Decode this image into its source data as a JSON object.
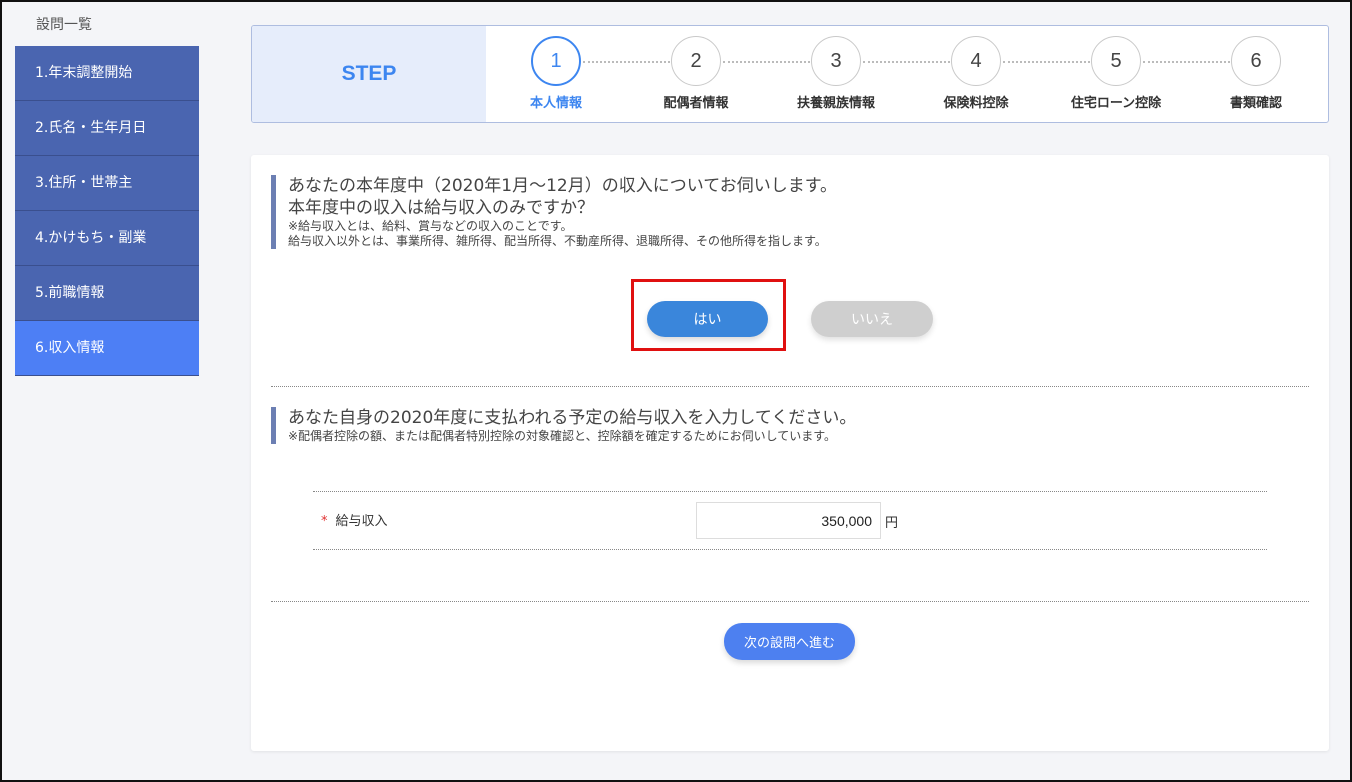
{
  "sidebar": {
    "title": "設問一覧",
    "items": [
      {
        "label": "1.年末調整開始"
      },
      {
        "label": "2.氏名・生年月日"
      },
      {
        "label": "3.住所・世帯主"
      },
      {
        "label": "4.かけもち・副業"
      },
      {
        "label": "5.前職情報"
      },
      {
        "label": "6.収入情報"
      }
    ]
  },
  "stepbar": {
    "label": "STEP",
    "steps": [
      {
        "num": "1",
        "name": "本人情報"
      },
      {
        "num": "2",
        "name": "配偶者情報"
      },
      {
        "num": "3",
        "name": "扶養親族情報"
      },
      {
        "num": "4",
        "name": "保険料控除"
      },
      {
        "num": "5",
        "name": "住宅ローン控除"
      },
      {
        "num": "6",
        "name": "書類確認"
      }
    ]
  },
  "question1": {
    "title_line1": "あなたの本年度中（2020年1月～12月）の収入についてお伺いします。",
    "title_line2": "本年度中の収入は給与収入のみですか？",
    "note_line1": "※給与収入とは、給料、賞与などの収入のことです。",
    "note_line2": "給与収入以外とは、事業所得、雑所得、配当所得、不動産所得、退職所得、その他所得を指します。",
    "yes_label": "はい",
    "no_label": "いいえ"
  },
  "question2": {
    "title": "あなた自身の2020年度に支払われる予定の給与収入を入力してください。",
    "note": "※配偶者控除の額、または配偶者特別控除の対象確認と、控除額を確定するためにお伺いしています。",
    "field_required_mark": "*",
    "field_label": "給与収入",
    "field_value": "350,000",
    "field_unit": "円"
  },
  "next_button": "次の設問へ進む",
  "colors": {
    "sidebar": "#4a65b0",
    "sidebar_active": "#4d7ff5",
    "accent": "#3d86f0",
    "highlight": "#e01010"
  }
}
